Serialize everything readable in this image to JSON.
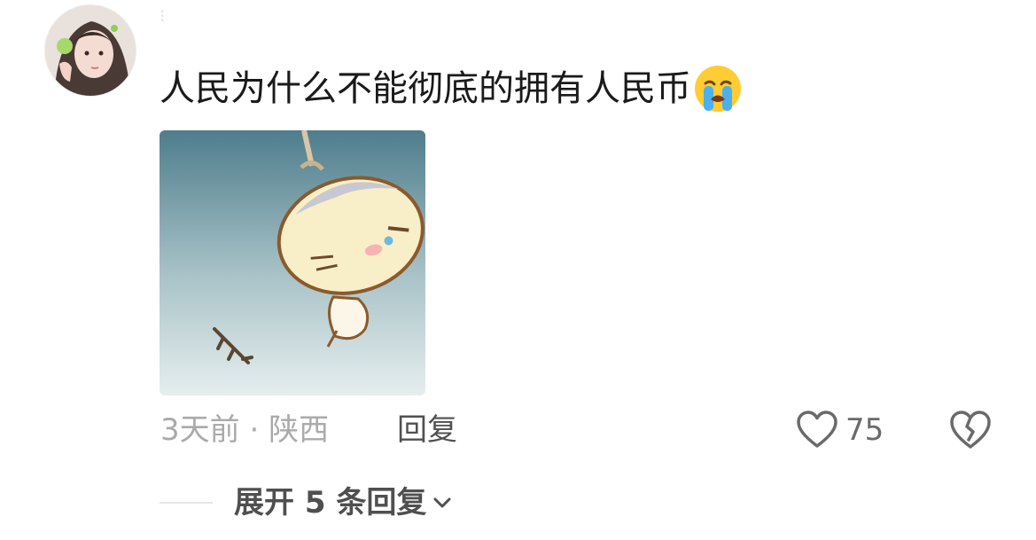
{
  "comment": {
    "text": "人民为什么不能彻底的拥有人民币",
    "emoji": "loudly-crying-face",
    "time": "3天前",
    "separator": "·",
    "location": "陕西",
    "reply_label": "回复",
    "likes": "75",
    "expand_label": "展开 5 条回复"
  },
  "colors": {
    "text": "#1a1a1a",
    "meta": "#aaaaaa",
    "action": "#505050"
  },
  "icons": {
    "like": "heart-outline-icon",
    "dislike": "broken-heart-icon",
    "expand": "chevron-down-icon"
  }
}
